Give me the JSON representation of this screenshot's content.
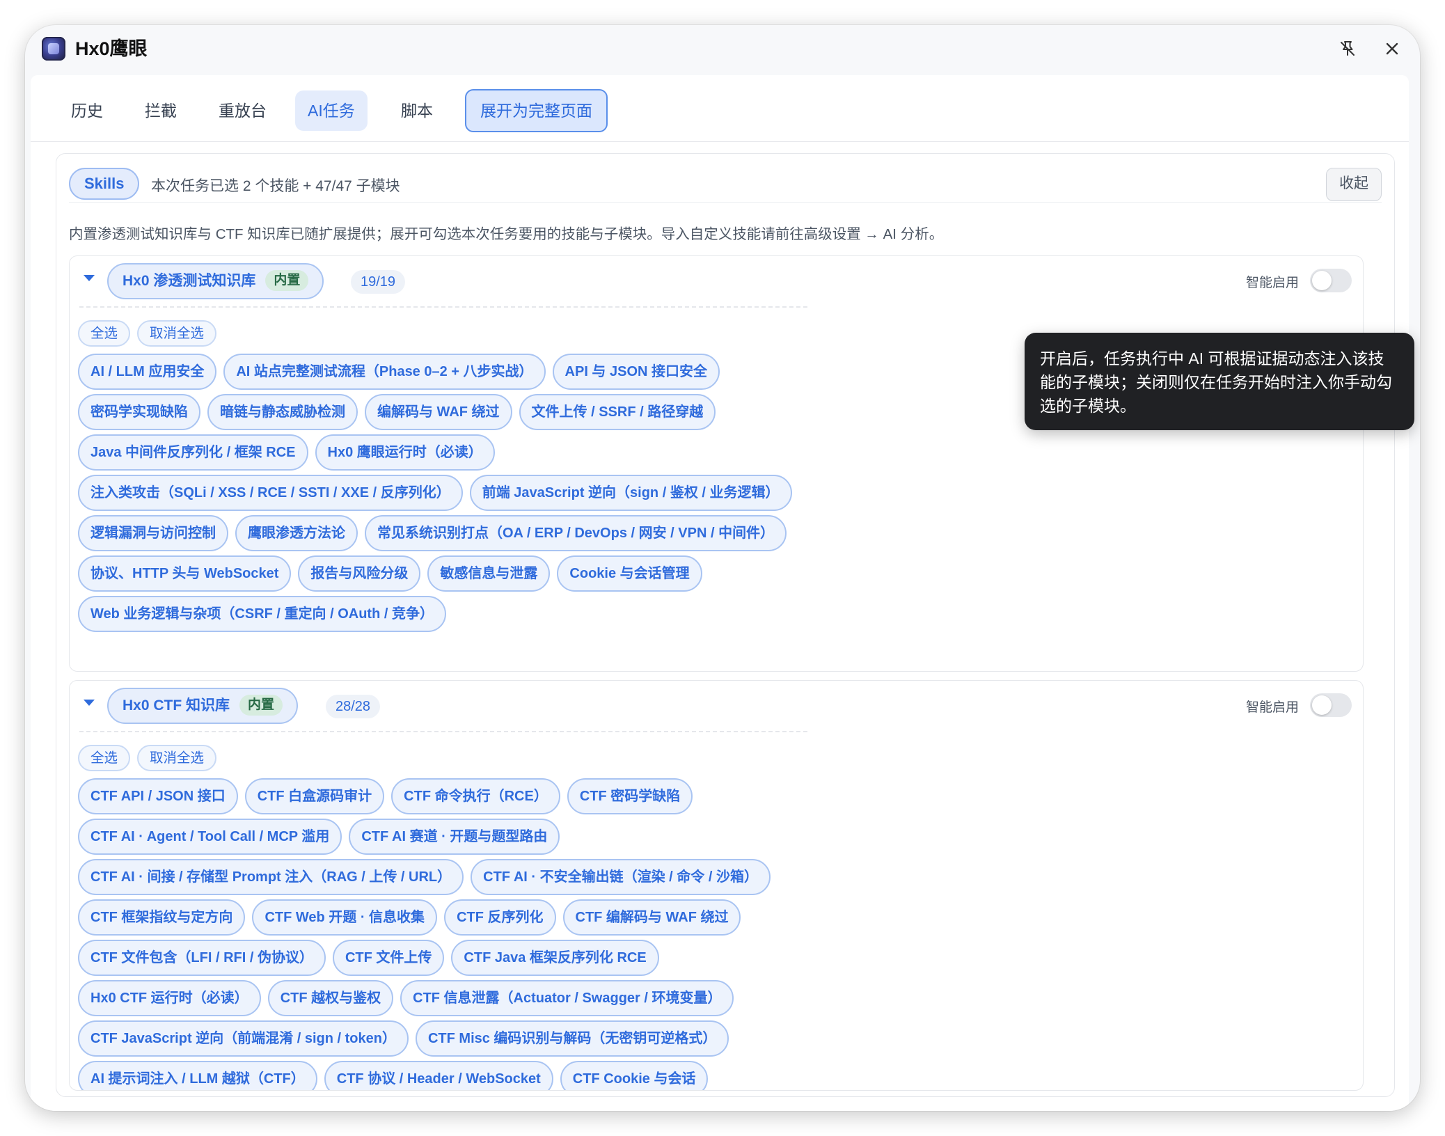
{
  "app": {
    "title": "Hx0鹰眼"
  },
  "tabs": [
    {
      "label": "历史",
      "active": false
    },
    {
      "label": "拦截",
      "active": false
    },
    {
      "label": "重放台",
      "active": false
    },
    {
      "label": "AI任务",
      "active": true
    },
    {
      "label": "脚本",
      "active": false
    }
  ],
  "expand_button": "展开为完整页面",
  "skills": {
    "pill": "Skills",
    "summary": "本次任务已选 2 个技能 + 47/47 子模块",
    "collapse": "收起",
    "description": "内置渗透测试知识库与 CTF 知识库已随扩展提供；展开可勾选本次任务要用的技能与子模块。导入自定义技能请前往高级设置 → AI 分析。"
  },
  "kb1": {
    "name": "Hx0 渗透测试知识库",
    "badge": "内置",
    "count": "19/19",
    "smart_label": "智能启用",
    "smart_enabled": false,
    "select_all": "全选",
    "deselect_all": "取消全选",
    "chips": [
      "AI / LLM 应用安全",
      "AI 站点完整测试流程（Phase 0–2 + 八步实战）",
      "API 与 JSON 接口安全",
      "密码学实现缺陷",
      "暗链与静态威胁检测",
      "编解码与 WAF 绕过",
      "文件上传 / SSRF / 路径穿越",
      "Java 中间件反序列化 / 框架 RCE",
      "Hx0 鹰眼运行时（必读）",
      "注入类攻击（SQLi / XSS / RCE / SSTI / XXE / 反序列化）",
      "前端 JavaScript 逆向（sign / 鉴权 / 业务逻辑）",
      "逻辑漏洞与访问控制",
      "鹰眼渗透方法论",
      "常见系统识别打点（OA / ERP / DevOps / 网安 / VPN / 中间件）",
      "协议、HTTP 头与 WebSocket",
      "报告与风险分级",
      "敏感信息与泄露",
      "Cookie 与会话管理",
      "Web 业务逻辑与杂项（CSRF / 重定向 / OAuth / 竞争）"
    ]
  },
  "kb2": {
    "name": "Hx0 CTF 知识库",
    "badge": "内置",
    "count": "28/28",
    "smart_label": "智能启用",
    "smart_enabled": false,
    "select_all": "全选",
    "deselect_all": "取消全选",
    "chips": [
      "CTF API / JSON 接口",
      "CTF 白盒源码审计",
      "CTF 命令执行（RCE）",
      "CTF 密码学缺陷",
      "CTF AI · Agent / Tool Call / MCP 滥用",
      "CTF AI 赛道 · 开题与题型路由",
      "CTF AI · 间接 / 存储型 Prompt 注入（RAG / 上传 / URL）",
      "CTF AI · 不安全输出链（渲染 / 命令 / 沙箱）",
      "CTF 框架指纹与定方向",
      "CTF Web 开题 · 信息收集",
      "CTF 反序列化",
      "CTF 编解码与 WAF 绕过",
      "CTF 文件包含（LFI / RFI / 伪协议）",
      "CTF 文件上传",
      "CTF Java 框架反序列化 RCE",
      "Hx0 CTF 运行时（必读）",
      "CTF 越权与鉴权",
      "CTF 信息泄露（Actuator / Swagger / 环境变量）",
      "CTF JavaScript 逆向（前端混淆 / sign / token）",
      "CTF Misc 编码识别与解码（无密钥可逆格式）",
      "AI 提示词注入 / LLM 越狱（CTF）",
      "CTF 协议 / Header / WebSocket",
      "CTF Cookie 与会话"
    ]
  },
  "tooltip": "开启后，任务执行中 AI 可根据证据动态注入该技能的子模块；关闭则仅在任务开始时注入你手动勾选的子模块。",
  "icons": {
    "pin": "pin-off-icon",
    "close": "close-icon",
    "caret": "caret-down-icon"
  },
  "colors": {
    "accent": "#2f6bdc",
    "chip_bg": "#edf3fd",
    "badge_green": "#276a45",
    "tooltip_bg": "#202124"
  }
}
